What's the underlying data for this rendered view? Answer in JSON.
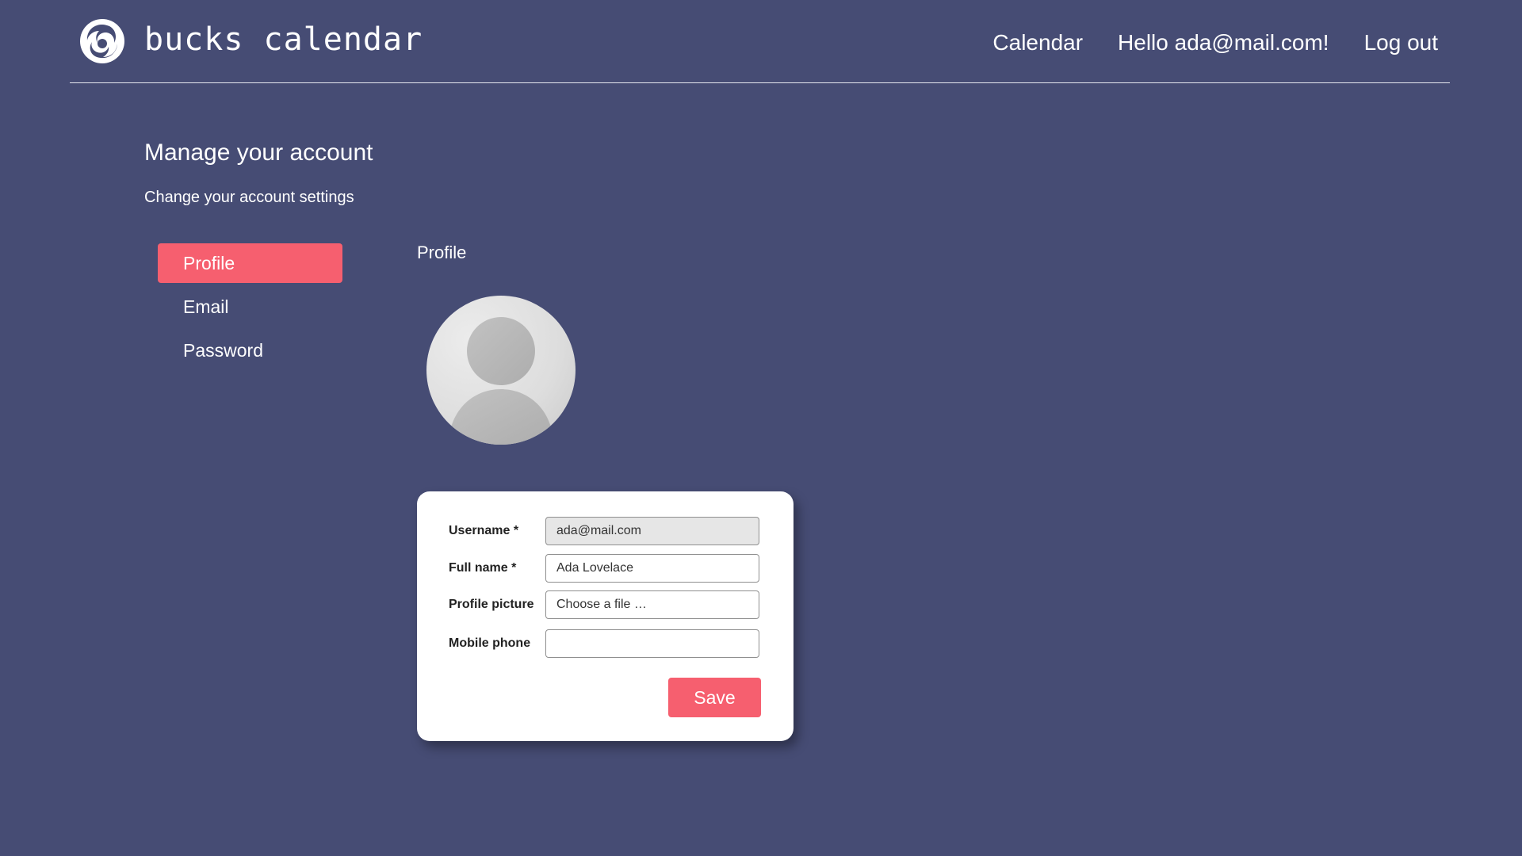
{
  "header": {
    "brand": "bucks calendar",
    "nav": {
      "calendar": "Calendar",
      "greeting": "Hello ada@mail.com!",
      "logout": "Log out"
    }
  },
  "page": {
    "title": "Manage your account",
    "subtitle": "Change your account settings"
  },
  "menu": {
    "items": [
      {
        "label": "Profile",
        "active": true
      },
      {
        "label": "Email",
        "active": false
      },
      {
        "label": "Password",
        "active": false
      }
    ]
  },
  "profile": {
    "section_label": "Profile",
    "avatar_icon": "user-silhouette-icon",
    "form": {
      "username_label": "Username *",
      "username_value": "ada@mail.com",
      "fullname_label": "Full name *",
      "fullname_value": "Ada Lovelace",
      "picture_label": "Profile picture",
      "picture_value": "Choose a file …",
      "phone_label": "Mobile phone",
      "phone_value": "",
      "save_label": "Save"
    }
  },
  "colors": {
    "background": "#464c74",
    "accent": "#f65f6f",
    "card": "#ffffff"
  }
}
